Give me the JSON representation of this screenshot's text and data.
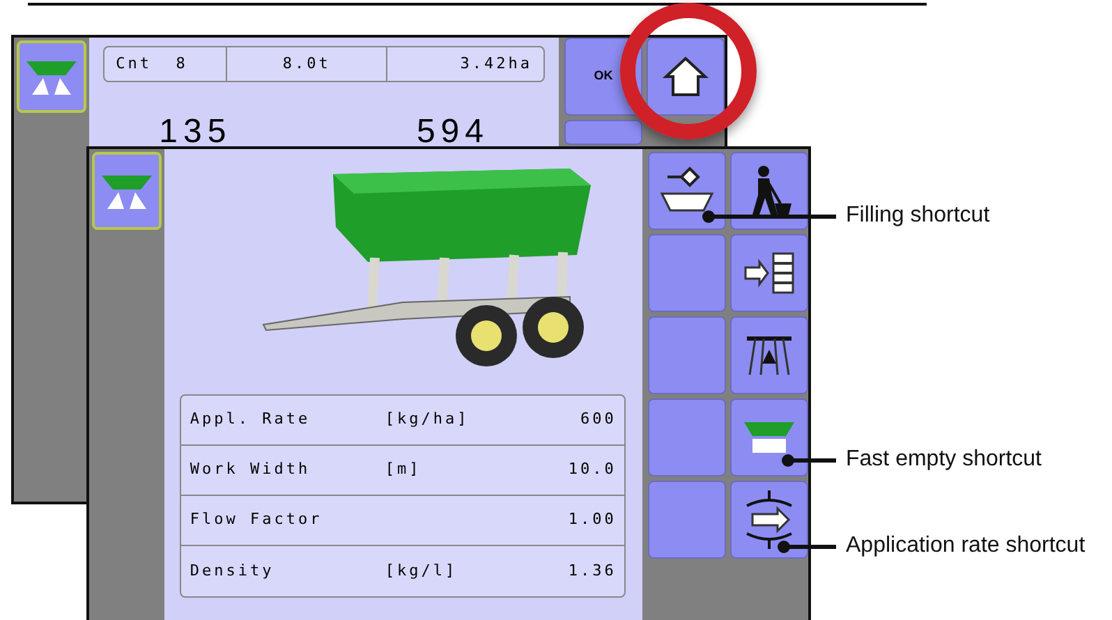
{
  "back_screen": {
    "info_bar": [
      "Cnt  8",
      "8.0t",
      "3.42ha"
    ],
    "readings": [
      "135",
      "594"
    ],
    "ok_button": "OK",
    "home_button": {
      "highlighted": true
    }
  },
  "front_screen": {
    "parameters": [
      {
        "label": "Appl. Rate",
        "unit": "[kg/ha]",
        "value": "600"
      },
      {
        "label": "Work Width",
        "unit": "[m]",
        "value": "10.0"
      },
      {
        "label": "Flow Factor",
        "value": "1.00"
      },
      {
        "label": "Density",
        "unit": "[kg/l]",
        "value": "1.36"
      }
    ]
  },
  "callouts": [
    "Filling shortcut",
    "Fast empty shortcut",
    "Application rate shortcut"
  ]
}
